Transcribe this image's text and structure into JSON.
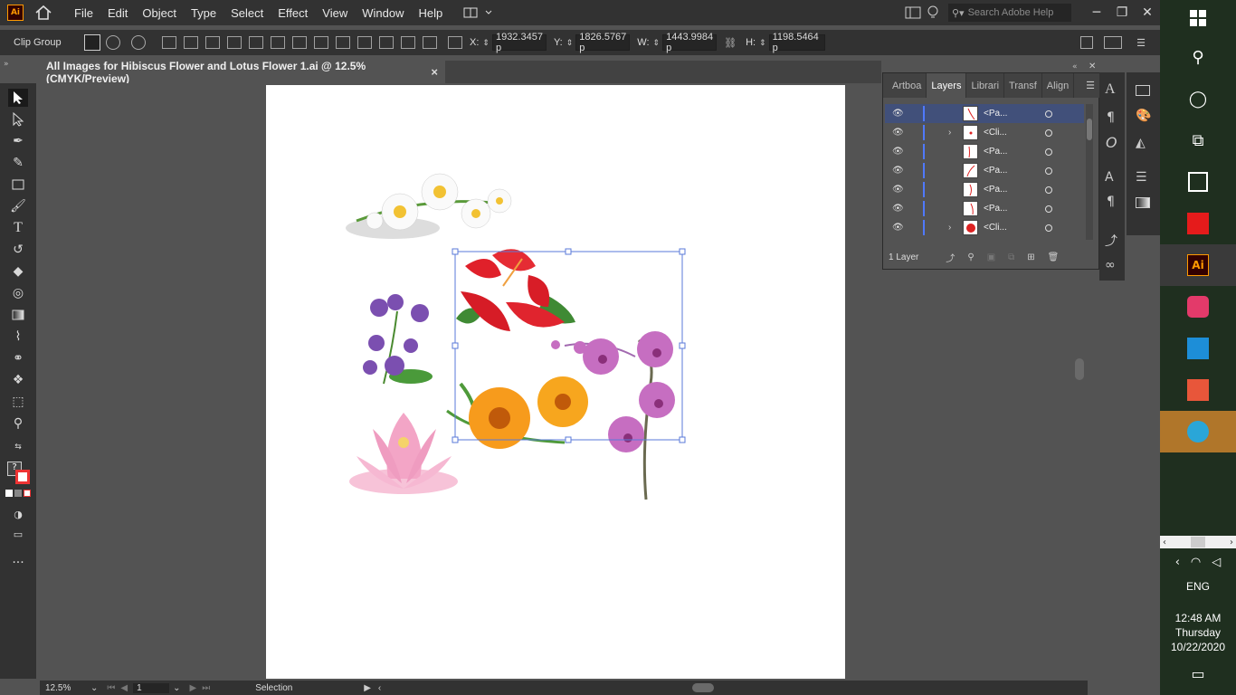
{
  "menubar": {
    "logo": "Ai",
    "items": [
      "File",
      "Edit",
      "Object",
      "Type",
      "Select",
      "Effect",
      "View",
      "Window",
      "Help"
    ],
    "search_placeholder": "Search Adobe Help"
  },
  "controlbar": {
    "selection_label": "Clip Group",
    "x_label": "X:",
    "x_value": "1932.3457 p",
    "y_label": "Y:",
    "y_value": "1826.5767 p",
    "w_label": "W:",
    "w_value": "1443.9984 p",
    "h_label": "H:",
    "h_value": "1198.5464 p"
  },
  "document": {
    "tab_title": "All Images for Hibiscus Flower and  Lotus Flower 1.ai @ 12.5% (CMYK/Preview)",
    "close": "×"
  },
  "layers_panel": {
    "tabs": [
      "Artboa",
      "Layers",
      "Librari",
      "Transf",
      "Align"
    ],
    "active_tab": "Layers",
    "rows": [
      {
        "name": "<Pa...",
        "has_chevron": false,
        "selected": true
      },
      {
        "name": "<Cli...",
        "has_chevron": true,
        "selected": false
      },
      {
        "name": "<Pa...",
        "has_chevron": false,
        "selected": false
      },
      {
        "name": "<Pa...",
        "has_chevron": false,
        "selected": false
      },
      {
        "name": "<Pa...",
        "has_chevron": false,
        "selected": false
      },
      {
        "name": "<Pa...",
        "has_chevron": false,
        "selected": false
      },
      {
        "name": "<Cli...",
        "has_chevron": true,
        "selected": false
      }
    ],
    "footer": "1 Layer"
  },
  "statusbar": {
    "zoom": "12.5%",
    "artboard_num": "1",
    "tool": "Selection"
  },
  "taskbar": {
    "lang": "ENG",
    "time": "12:48 AM",
    "day": "Thursday",
    "date": "10/22/2020"
  },
  "colors": {
    "accent": "#4f79ff",
    "selection": "#5a7ad9"
  }
}
